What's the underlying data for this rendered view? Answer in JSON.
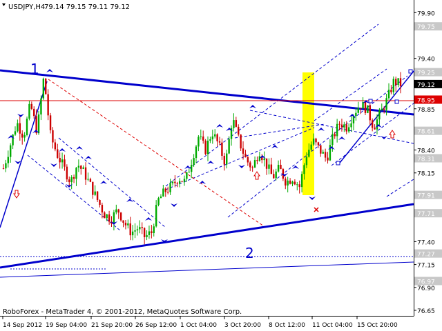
{
  "header": {
    "symbol": "USDJPY,H4",
    "ohlc": "79.14 79.15 79.11 79.12"
  },
  "footer": {
    "copyright": "RoboForex - MetaTrader 4, © 2001-2012, MetaQuotes Software Corp."
  },
  "annotations": {
    "wave_1": "1",
    "wave_2": "2"
  },
  "colors": {
    "background": "#ffffff",
    "trendline": "#0000cc",
    "channel": "#0000cc",
    "horizontal_level": "#dd0000",
    "bull_candle": "#00aa00",
    "bear_candle": "#cc0000",
    "highlight_zone": "#ffff00",
    "price_label_bg": "#c8c8c8",
    "current_price_bg": "#000000"
  },
  "chart_data": {
    "type": "candlestick",
    "symbol": "USDJPY",
    "timeframe": "H4",
    "ylim": [
      76.65,
      80.0
    ],
    "y_ticks": [
      "79.90",
      "79.75",
      "79.40",
      "79.25",
      "79.12",
      "78.95",
      "78.85",
      "78.61",
      "78.40",
      "78.31",
      "78.15",
      "77.91",
      "77.71",
      "77.40",
      "77.27",
      "77.15",
      "76.97",
      "76.90",
      "76.65"
    ],
    "x_ticks": [
      "14 Sep 2012",
      "19 Sep 04:00",
      "21 Sep 20:00",
      "26 Sep 12:00",
      "1 Oct 04:00",
      "3 Oct 20:00",
      "8 Oct 12:00",
      "11 Oct 04:00",
      "15 Oct 20:00"
    ],
    "current_price": 79.12,
    "levels": [
      79.75,
      79.25,
      78.95,
      78.61,
      78.31,
      77.91,
      77.71,
      77.27,
      76.97
    ],
    "close_path": [
      78.2,
      78.45,
      78.7,
      78.55,
      78.9,
      78.6,
      79.2,
      78.55,
      78.35,
      78.2,
      78.05,
      78.25,
      78.15,
      78.0,
      77.85,
      77.7,
      77.65,
      77.75,
      77.6,
      77.5,
      77.55,
      77.45,
      77.5,
      77.85,
      77.95,
      78.0,
      78.1,
      78.05,
      78.3,
      78.55,
      78.4,
      78.6,
      78.45,
      78.25,
      78.75,
      78.5,
      78.3,
      78.2,
      78.4,
      78.25,
      78.1,
      78.2,
      78.05,
      78.1,
      78.0,
      78.35,
      78.5,
      78.4,
      78.3,
      78.55,
      78.7,
      78.65,
      78.8,
      78.9,
      78.85,
      78.65,
      78.8,
      78.95,
      79.15,
      79.12
    ]
  }
}
